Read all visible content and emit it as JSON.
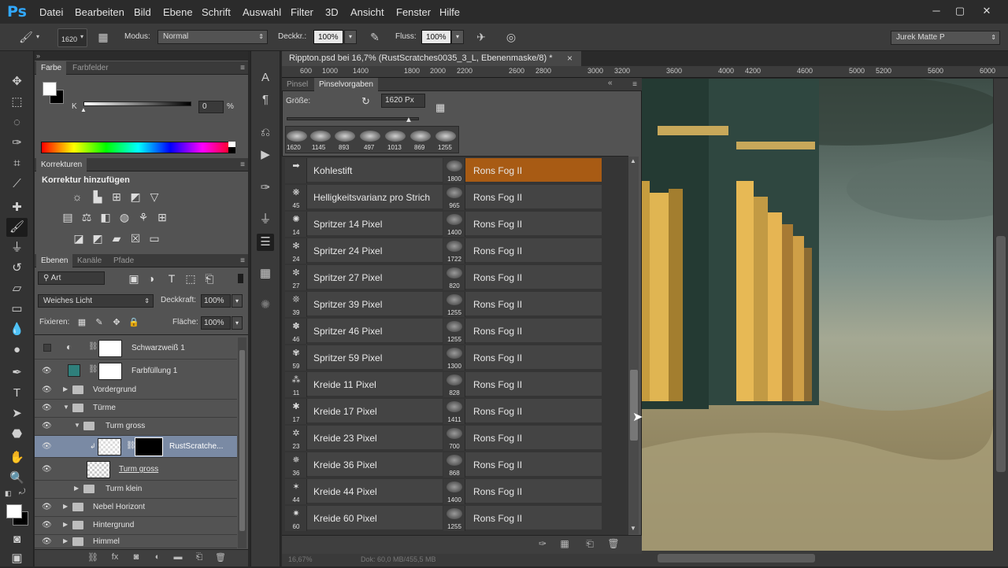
{
  "app": {
    "logo": "Ps"
  },
  "menu": [
    "Datei",
    "Bearbeiten",
    "Bild",
    "Ebene",
    "Schrift",
    "Auswahl",
    "Filter",
    "3D",
    "Ansicht",
    "Fenster",
    "Hilfe"
  ],
  "window_controls": {
    "minimize": "─",
    "maximize": "▢",
    "close": "✕"
  },
  "options": {
    "brush_size": "1620",
    "modus_label": "Modus:",
    "modus_value": "Normal",
    "deckkraft_label": "Deckkr.:",
    "deckkraft_value": "100%",
    "fluss_label": "Fluss:",
    "fluss_value": "100%",
    "workspace": "Jurek Matte P"
  },
  "color_panel": {
    "tabs": [
      "Farbe",
      "Farbfelder"
    ],
    "k_label": "K",
    "k_value": "0",
    "k_unit": "%"
  },
  "corrections_panel": {
    "tab": "Korrekturen",
    "title": "Korrektur hinzufügen"
  },
  "layers_panel": {
    "tabs": [
      "Ebenen",
      "Kanäle",
      "Pfade"
    ],
    "filter_label": "Art",
    "blend_mode": "Weiches Licht",
    "opacity_label": "Deckkraft:",
    "opacity_value": "100%",
    "lock_label": "Fixieren:",
    "fill_label": "Fläche:",
    "fill_value": "100%",
    "layers": [
      {
        "name": "Schwarzweiß 1"
      },
      {
        "name": "Farbfüllung 1"
      },
      {
        "name": "Vordergrund"
      },
      {
        "name": "Türme"
      },
      {
        "name": "Turm gross"
      },
      {
        "name": "RustScratche..."
      },
      {
        "name": "Turm gross"
      },
      {
        "name": "Turm klein"
      },
      {
        "name": "Nebel Horizont"
      },
      {
        "name": "Hintergrund"
      },
      {
        "name": "Himmel"
      }
    ]
  },
  "document": {
    "tab_title": "Rippton.psd bei 16,7% (RustScratches0035_3_L, Ebenenmaske/8) *",
    "close": "×",
    "ruler": [
      "600",
      "1000",
      "1400",
      "1800",
      "2000",
      "2200",
      "2600",
      "2800",
      "3000",
      "3200",
      "3600",
      "4000",
      "4200",
      "4600",
      "5000",
      "5200",
      "5600",
      "6000"
    ]
  },
  "brush_presets": {
    "tabs": [
      "Pinsel",
      "Pinselvorgaben"
    ],
    "size_label": "Größe:",
    "size_value": "1620 Px",
    "sizes": [
      "1620",
      "1145",
      "893",
      "497",
      "1013",
      "869",
      "1255"
    ],
    "left": [
      {
        "name": "Kohlestift",
        "num": ""
      },
      {
        "name": "Helligkeitsvarianz pro Strich",
        "num": "45"
      },
      {
        "name": "Spritzer 14 Pixel",
        "num": "14"
      },
      {
        "name": "Spritzer 24 Pixel",
        "num": "24"
      },
      {
        "name": "Spritzer 27 Pixel",
        "num": "27"
      },
      {
        "name": "Spritzer 39 Pixel",
        "num": "39"
      },
      {
        "name": "Spritzer 46 Pixel",
        "num": "46"
      },
      {
        "name": "Spritzer 59 Pixel",
        "num": "59"
      },
      {
        "name": "Kreide 11 Pixel",
        "num": "11"
      },
      {
        "name": "Kreide 17 Pixel",
        "num": "17"
      },
      {
        "name": "Kreide 23 Pixel",
        "num": "23"
      },
      {
        "name": "Kreide 36 Pixel",
        "num": "36"
      },
      {
        "name": "Kreide 44 Pixel",
        "num": "44"
      },
      {
        "name": "Kreide 60 Pixel",
        "num": "60"
      }
    ],
    "right": [
      {
        "name": "Rons Fog II",
        "num": "1800"
      },
      {
        "name": "Rons Fog II",
        "num": "965"
      },
      {
        "name": "Rons Fog II",
        "num": "1400"
      },
      {
        "name": "Rons Fog II",
        "num": "1722"
      },
      {
        "name": "Rons Fog II",
        "num": "820"
      },
      {
        "name": "Rons Fog II",
        "num": "1255"
      },
      {
        "name": "Rons Fog II",
        "num": "1255"
      },
      {
        "name": "Rons Fog II",
        "num": "1300"
      },
      {
        "name": "Rons Fog II",
        "num": "828"
      },
      {
        "name": "Rons Fog II",
        "num": "1411"
      },
      {
        "name": "Rons Fog II",
        "num": "700"
      },
      {
        "name": "Rons Fog II",
        "num": "868"
      },
      {
        "name": "Rons Fog II",
        "num": "1400"
      },
      {
        "name": "Rons Fog II",
        "num": "1255"
      }
    ]
  },
  "status": {
    "zoom": "16,67%",
    "doc": "Dok: 60,0 MB/455,5 MB"
  }
}
